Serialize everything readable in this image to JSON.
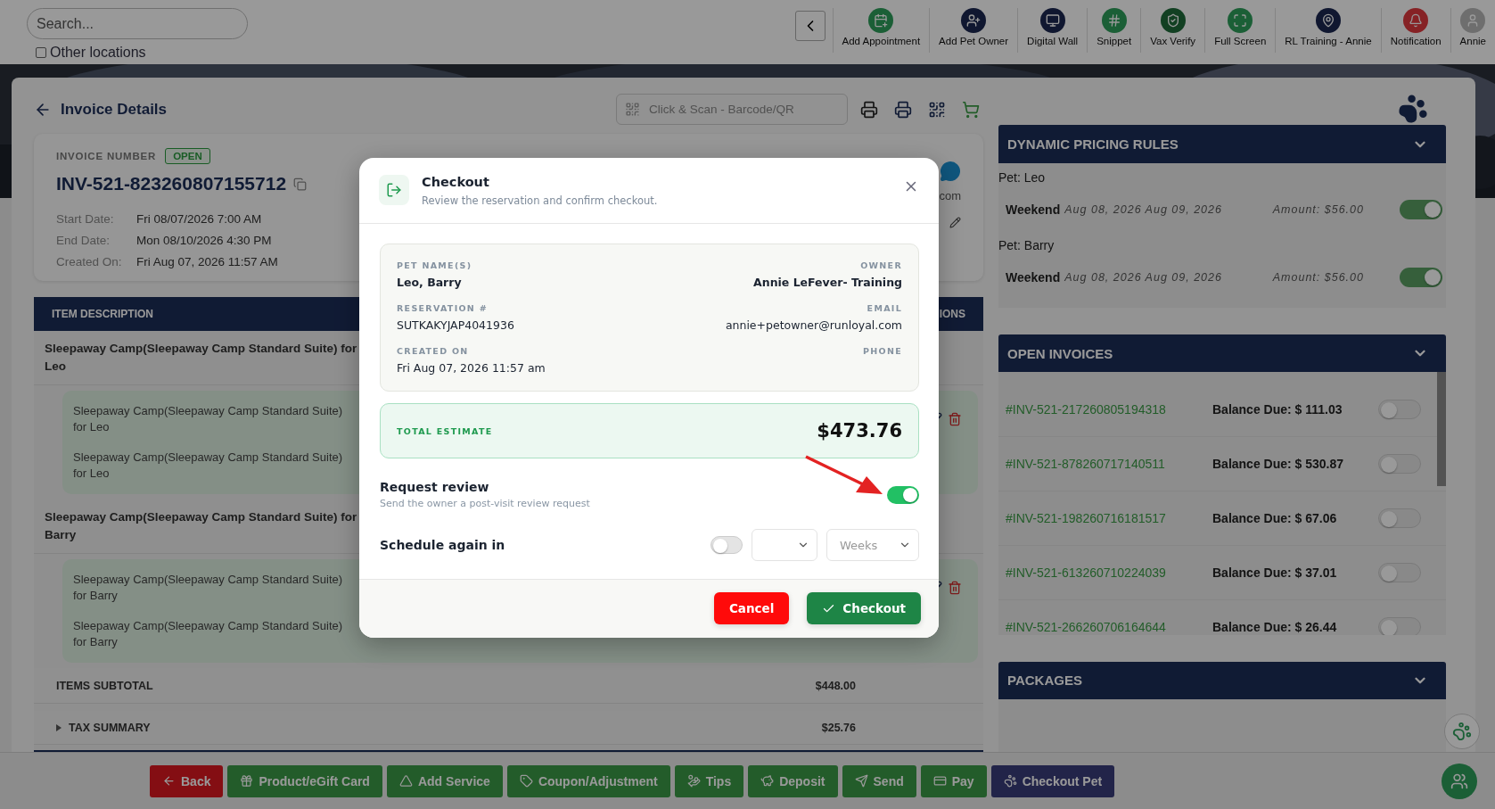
{
  "search": {
    "placeholder": "Search..."
  },
  "other_locations": {
    "label": "Other locations",
    "checked": false
  },
  "toolbar": [
    {
      "label": "Add Appointment",
      "kind": "calendar"
    },
    {
      "label": "Add Pet Owner",
      "kind": "person"
    },
    {
      "label": "Digital Wall",
      "kind": "wall"
    },
    {
      "label": "Snippet",
      "kind": "hash"
    },
    {
      "label": "Vax Verify",
      "kind": "shield"
    },
    {
      "label": "Full Screen",
      "kind": "expand"
    },
    {
      "label": "RL Training - Annie",
      "kind": "pin"
    },
    {
      "label": "Notification",
      "kind": "bell"
    },
    {
      "label": "Annie",
      "kind": "avatar"
    }
  ],
  "page_title": "Invoice Details",
  "scan": {
    "placeholder": "Click & Scan - Barcode/QR"
  },
  "invoice": {
    "label": "INVOICE NUMBER",
    "status": "OPEN",
    "number": "INV-521-823260807155712",
    "fields": [
      {
        "label": "Start Date:",
        "value": "Fri 08/07/2026 7:00 AM"
      },
      {
        "label": "End Date:",
        "value": "Mon 08/10/2026 4:30 PM"
      },
      {
        "label": "Created On:",
        "value": "Fri Aug 07, 2026 11:57 AM"
      }
    ],
    "contact_partial": "com"
  },
  "items_table": {
    "columns": [
      "ITEM DESCRIPTION",
      "IONS"
    ],
    "groups": [
      {
        "title": "Sleepaway Camp(Sleepaway Camp Standard Suite) for Leo",
        "items": [
          "Sleepaway Camp(Sleepaway Camp Standard Suite) for Leo",
          "Sleepaway Camp(Sleepaway Camp Standard Suite) for Leo"
        ]
      },
      {
        "title": "Sleepaway Camp(Sleepaway Camp Standard Suite) for Barry",
        "items": [
          "Sleepaway Camp(Sleepaway Camp Standard Suite) for Barry",
          "Sleepaway Camp(Sleepaway Camp Standard Suite) for Barry"
        ]
      }
    ],
    "subtotal": {
      "label": "ITEMS SUBTOTAL",
      "value": "$448.00"
    },
    "tax": {
      "label": "TAX SUMMARY",
      "value": "$25.76",
      "expanded": false
    }
  },
  "dynamic_pricing": {
    "title": "DYNAMIC PRICING RULES",
    "expanded": true,
    "pets": [
      {
        "pet": "Pet: Leo",
        "rules": [
          {
            "name": "Weekend",
            "dates": "Aug 08, 2026 Aug 09, 2026",
            "amount": "Amount: $56.00",
            "on": true
          }
        ]
      },
      {
        "pet": "Pet: Barry",
        "rules": [
          {
            "name": "Weekend",
            "dates": "Aug 08, 2026 Aug 09, 2026",
            "amount": "Amount: $56.00",
            "on": true
          }
        ]
      }
    ]
  },
  "open_invoices": {
    "title": "OPEN INVOICES",
    "expanded": true,
    "rows": [
      {
        "number": "#INV-521-217260805194318",
        "balance": "Balance Due: $ 111.03",
        "on": false
      },
      {
        "number": "#INV-521-878260717140511",
        "balance": "Balance Due: $ 530.87",
        "on": false
      },
      {
        "number": "#INV-521-198260716181517",
        "balance": "Balance Due: $ 67.06",
        "on": false
      },
      {
        "number": "#INV-521-613260710224039",
        "balance": "Balance Due: $ 37.01",
        "on": false
      },
      {
        "number": "#INV-521-266260706164644",
        "balance": "Balance Due: $ 26.44",
        "on": false
      }
    ]
  },
  "packages": {
    "title": "PACKAGES",
    "expanded": true
  },
  "actions": [
    {
      "label": "Back",
      "kind": "back"
    },
    {
      "label": "Product/eGift Card",
      "kind": "gift"
    },
    {
      "label": "Add Service",
      "kind": "service"
    },
    {
      "label": "Coupon/Adjustment",
      "kind": "coupon"
    },
    {
      "label": "Tips",
      "kind": "tips"
    },
    {
      "label": "Deposit",
      "kind": "deposit"
    },
    {
      "label": "Send",
      "kind": "send"
    },
    {
      "label": "Pay",
      "kind": "pay"
    },
    {
      "label": "Checkout Pet",
      "kind": "checkout"
    }
  ],
  "modal": {
    "title": "Checkout",
    "subtitle": "Review the reservation and confirm checkout.",
    "details": [
      {
        "left": {
          "label": "PET NAME(S)",
          "value": "Leo, Barry"
        },
        "right": {
          "label": "OWNER",
          "value": "Annie LeFever- Training"
        }
      },
      {
        "left": {
          "label": "RESERVATION #",
          "value": "SUTKAKYJAP4041936"
        },
        "right": {
          "label": "EMAIL",
          "value": "annie+petowner@runloyal.com"
        }
      },
      {
        "left": {
          "label": "CREATED ON",
          "value": "Fri Aug 07, 2026 11:57 am"
        },
        "right": {
          "label": "PHONE"
        }
      }
    ],
    "total": {
      "label": "TOTAL ESTIMATE",
      "value": "$473.76"
    },
    "request_review": {
      "title": "Request review",
      "hint": "Send the owner a post-visit review request",
      "on": true
    },
    "schedule": {
      "label": "Schedule again in",
      "on": false,
      "unit": "Weeks"
    },
    "cancel": "Cancel",
    "confirm": "Checkout"
  }
}
